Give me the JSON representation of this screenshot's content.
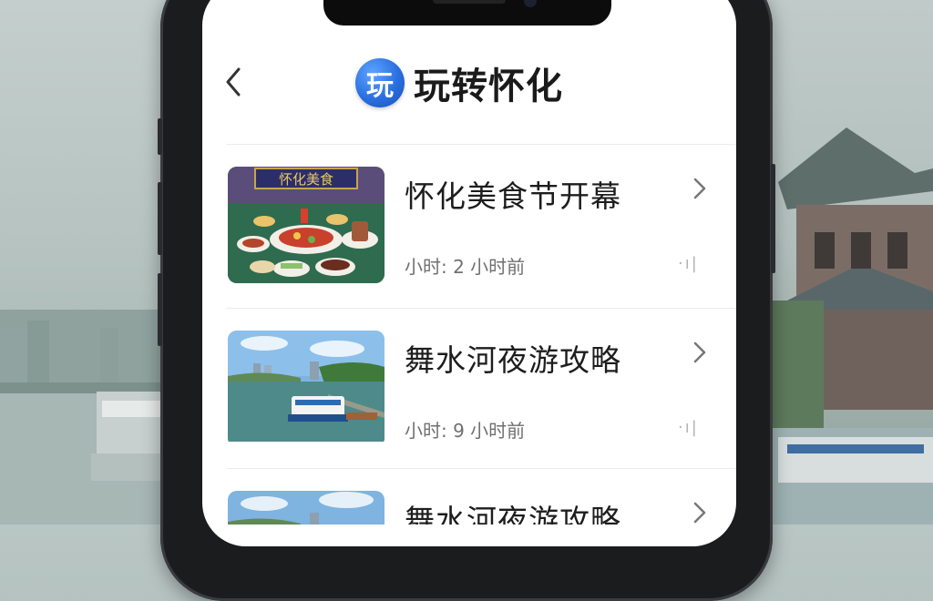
{
  "header": {
    "back_label": "<",
    "logo_glyph": "玩",
    "title": "玩转怀化"
  },
  "articles": [
    {
      "title": "怀化美食节开幕",
      "meta": "小时: 2 小时前",
      "more": "·ı|",
      "thumb": "food-festival-photo"
    },
    {
      "title": "舞水河夜游攻略",
      "meta": "小时: 9 小时前",
      "more": "·ı|",
      "thumb": "river-cruise-photo"
    },
    {
      "title": "舞水河夜游攻略",
      "meta": "",
      "more": "",
      "thumb": "river-cruise-photo"
    }
  ],
  "banner_text": "怀化美食",
  "colors": {
    "accent": "#2a6fe0",
    "text": "#1d1d1d",
    "meta": "#707070"
  }
}
